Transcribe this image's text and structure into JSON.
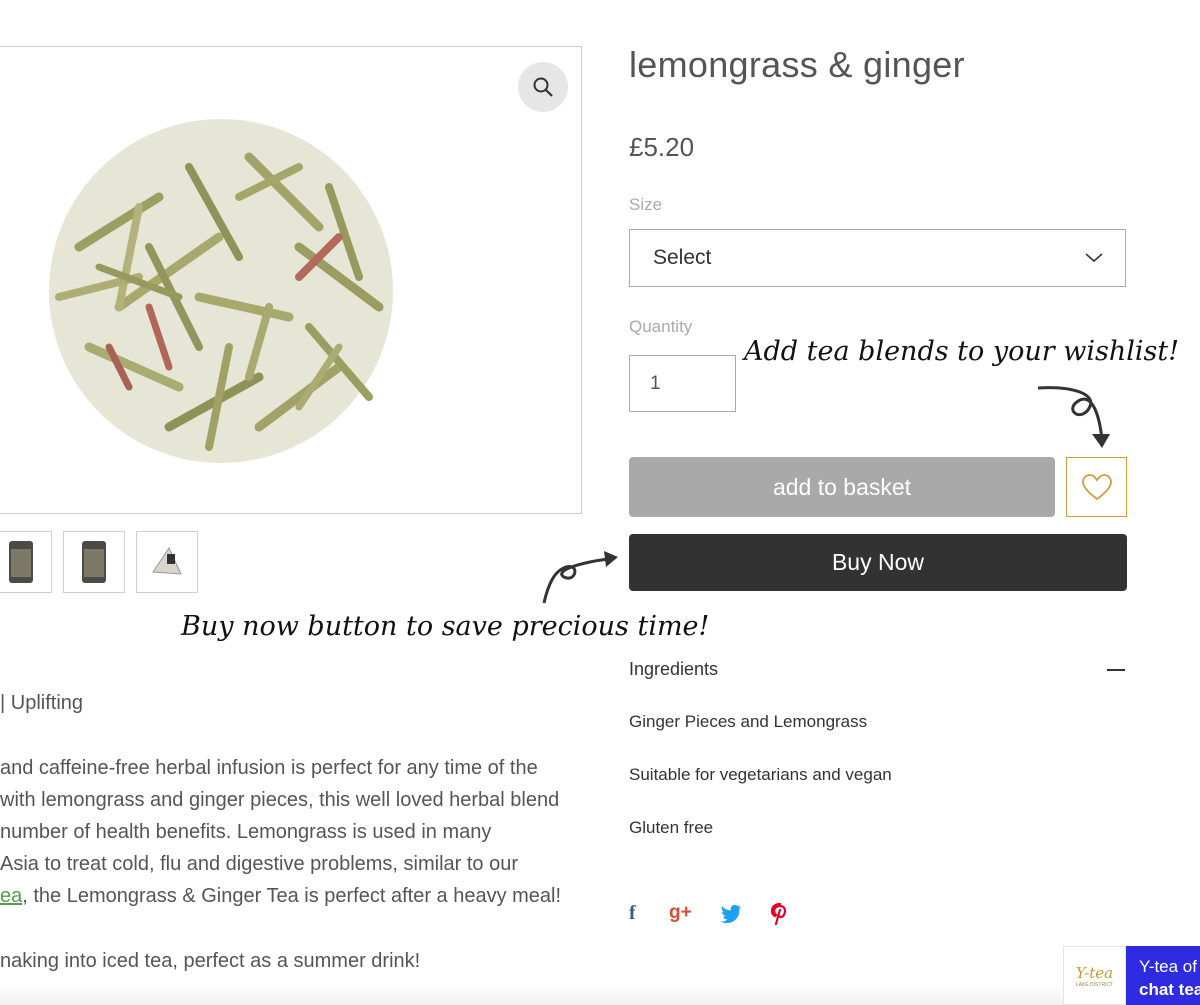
{
  "product": {
    "title": "lemongrass & ginger",
    "price": "£5.20",
    "size_label": "Size",
    "size_selected": "Select",
    "quantity_label": "Quantity",
    "quantity_value": "1",
    "add_to_basket_label": "add to basket",
    "buy_now_label": "Buy Now"
  },
  "annotations": {
    "wishlist_note": "Add tea blends to your wishlist!",
    "buy_now_note": "Buy now button to save precious time!"
  },
  "ingredients": {
    "title": "Ingredients",
    "lines": [
      "Ginger Pieces and Lemongrass",
      "Suitable for vegetarians and vegan",
      "Gluten free"
    ]
  },
  "description": {
    "tagline": "| Uplifting",
    "lines": [
      " and caffeine-free herbal infusion is perfect for any time of the",
      " with lemongrass and ginger pieces, this well loved herbal blend",
      " number of health benefits. Lemongrass is used in many",
      "Asia to treat cold, flu and digestive problems, similar to our"
    ],
    "link_text": "ea",
    "line5_rest": ", the Lemongrass & Ginger Tea is perfect after a heavy meal!",
    "line6": "naking into iced tea, perfect as a summer drink!"
  },
  "share": {
    "facebook": "f",
    "google_plus": "g+",
    "twitter_color": "#1da1f2",
    "facebook_color": "#3b5998",
    "google_color": "#dd4b39",
    "pinterest_color": "#e60023"
  },
  "chat": {
    "logo_text": "Y-tea",
    "logo_subtext": "LAKE DISTRICT",
    "line1": "Y-tea of",
    "line2": "chat tea"
  },
  "colors": {
    "buy_now_bg": "#323232",
    "add_basket_bg": "#a9a9a9",
    "wishlist_border": "#d49a3c",
    "chat_bg": "#2f2be0"
  }
}
